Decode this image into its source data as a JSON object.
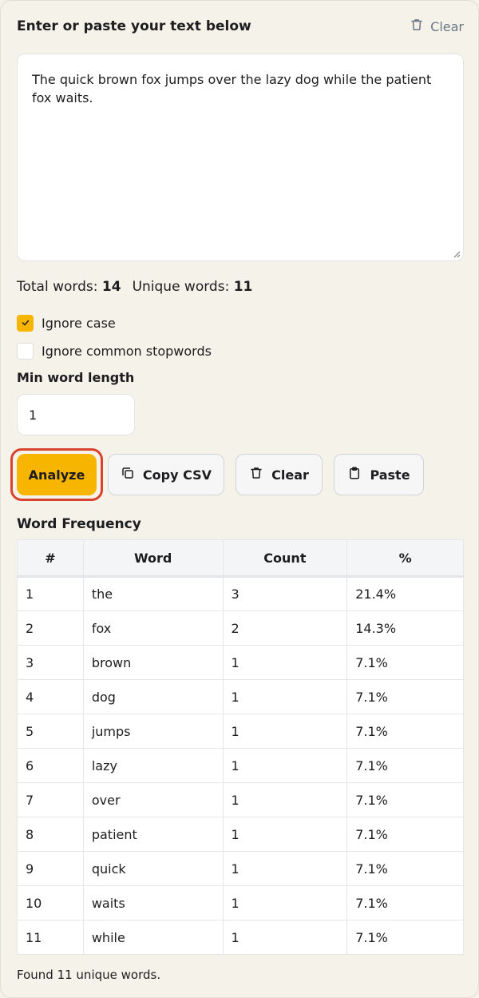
{
  "header": {
    "title": "Enter or paste your text below",
    "clear_label": "Clear"
  },
  "input": {
    "text": "The quick brown fox jumps over the lazy dog while the patient fox waits."
  },
  "stats": {
    "total_label": "Total words:",
    "total_value": "14",
    "unique_label": "Unique words:",
    "unique_value": "11"
  },
  "options": {
    "ignore_case_label": "Ignore case",
    "ignore_case_checked": true,
    "ignore_stopwords_label": "Ignore common stopwords",
    "ignore_stopwords_checked": false,
    "min_length_label": "Min word length",
    "min_length_value": "1"
  },
  "buttons": {
    "analyze": "Analyze",
    "copy_csv": "Copy CSV",
    "clear": "Clear",
    "paste": "Paste"
  },
  "colors": {
    "accent": "#f7b500",
    "focus_ring": "#d9432e"
  },
  "results": {
    "title": "Word Frequency",
    "columns": [
      "#",
      "Word",
      "Count",
      "%"
    ],
    "rows": [
      [
        "1",
        "the",
        "3",
        "21.4%"
      ],
      [
        "2",
        "fox",
        "2",
        "14.3%"
      ],
      [
        "3",
        "brown",
        "1",
        "7.1%"
      ],
      [
        "4",
        "dog",
        "1",
        "7.1%"
      ],
      [
        "5",
        "jumps",
        "1",
        "7.1%"
      ],
      [
        "6",
        "lazy",
        "1",
        "7.1%"
      ],
      [
        "7",
        "over",
        "1",
        "7.1%"
      ],
      [
        "8",
        "patient",
        "1",
        "7.1%"
      ],
      [
        "9",
        "quick",
        "1",
        "7.1%"
      ],
      [
        "10",
        "waits",
        "1",
        "7.1%"
      ],
      [
        "11",
        "while",
        "1",
        "7.1%"
      ]
    ],
    "footer": "Found 11 unique words."
  }
}
